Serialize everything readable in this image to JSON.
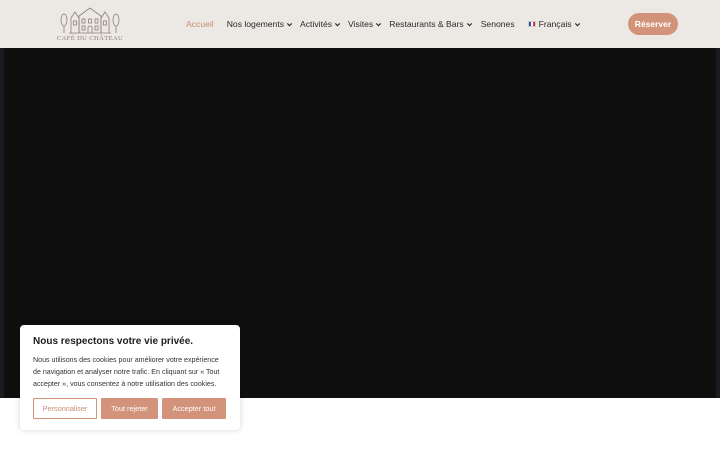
{
  "brand": {
    "logo_text": "CAFÉ DU CHÂTEAU"
  },
  "nav": {
    "items": [
      {
        "label": "Accueil",
        "dropdown": false,
        "active": true
      },
      {
        "label": "Nos logements",
        "dropdown": true,
        "active": false
      },
      {
        "label": "Activités",
        "dropdown": true,
        "active": false
      },
      {
        "label": "Visites",
        "dropdown": true,
        "active": false
      },
      {
        "label": "Restaurants & Bars",
        "dropdown": true,
        "active": false
      },
      {
        "label": "Senones",
        "dropdown": false,
        "active": false
      }
    ],
    "language": {
      "label": "Français",
      "flag": "french-flag"
    }
  },
  "header": {
    "reserve_label": "Réserver"
  },
  "cookie": {
    "title": "Nous respectons votre vie privée.",
    "text": "Nous utilisons des cookies pour améliorer votre expérience de navigation et analyser notre trafic. En cliquant sur « Tout accepter », vous consentez à notre utilisation des cookies.",
    "customize_label": "Personnaliser",
    "reject_label": "Tout rejeter",
    "accept_label": "Accepter tout"
  },
  "colors": {
    "accent": "#d2937a",
    "header_bg": "#ece9e4",
    "hero_bg": "#0f0f0f",
    "active_nav": "#c98c72"
  }
}
